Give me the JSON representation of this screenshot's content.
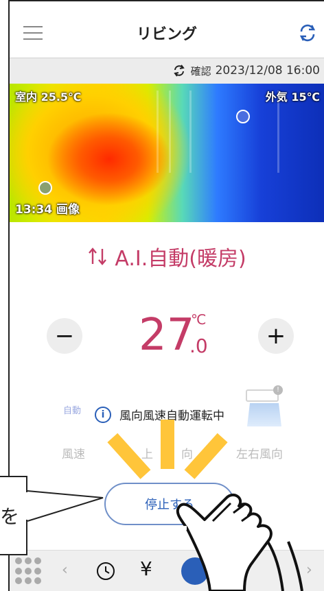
{
  "header": {
    "title": "リビング",
    "confirm_label": "確認",
    "confirm_datetime": "2023/12/08 16:00"
  },
  "thermal": {
    "indoor_label": "室内 25.5℃",
    "outdoor_label": "外気 15℃",
    "image_time": "13:34 画像"
  },
  "mode": {
    "label": "A.I.自動(暖房)"
  },
  "temperature": {
    "minus_symbol": "−",
    "plus_symbol": "+",
    "integer": "27",
    "decimal": ".0",
    "unit": "℃"
  },
  "wind": {
    "auto_label": "自動",
    "info_text": "風向風速自動運転中",
    "speed_label": "風速",
    "vertical_label_left": "上",
    "vertical_label_right": "向",
    "horizontal_label": "左右風向",
    "ac_badge": "!"
  },
  "actions": {
    "stop_label": "停止する"
  },
  "bottom_bar": {
    "yen_symbol": "¥",
    "prev_arrow": "‹",
    "next_arrow": "›"
  },
  "callout": {
    "text": "を"
  },
  "colors": {
    "accent": "#c43c67",
    "primary_blue": "#2a5fb8",
    "highlight": "#ffc53a"
  },
  "icons": [
    "menu-icon",
    "refresh-icon",
    "sync-icon",
    "ac-arrows-icon",
    "info-icon",
    "clock-icon",
    "yen-icon",
    "touch-icon",
    "grid-icon",
    "hand-pointer-icon"
  ]
}
